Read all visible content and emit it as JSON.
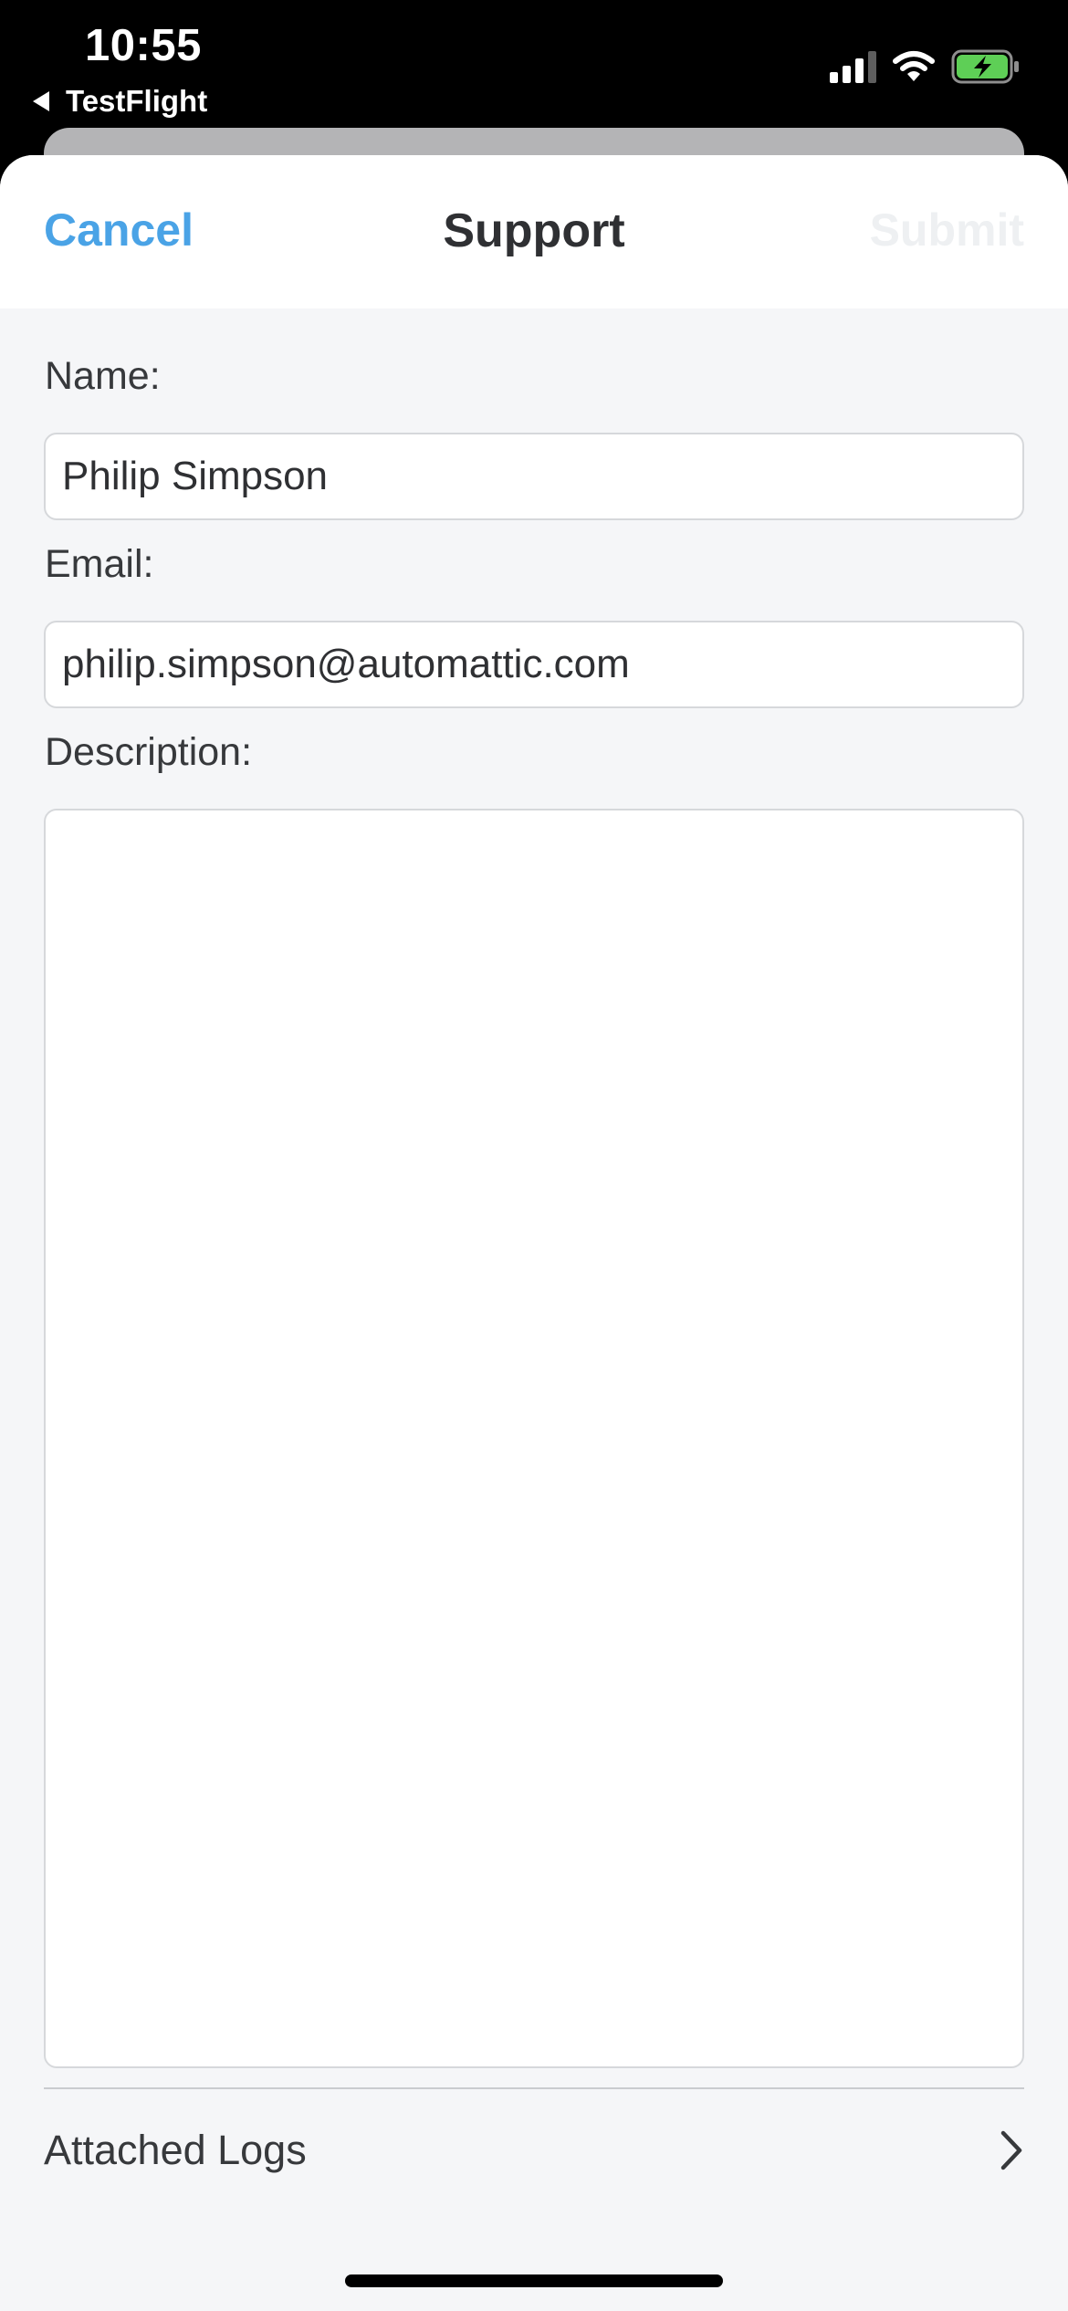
{
  "status_bar": {
    "time": "10:55",
    "back_app": "TestFlight",
    "icons": [
      "cellular-signal-icon",
      "wifi-icon",
      "battery-charging-icon"
    ]
  },
  "nav": {
    "cancel_label": "Cancel",
    "title": "Support",
    "submit_label": "Submit"
  },
  "form": {
    "name_label": "Name:",
    "name_value": "Philip Simpson",
    "email_label": "Email:",
    "email_value": "philip.simpson@automattic.com",
    "description_label": "Description:",
    "description_value": ""
  },
  "logs": {
    "label": "Attached Logs",
    "icon": "chevron-right-icon"
  },
  "colors": {
    "accent": "#4aa3e6",
    "sheet_background": "#f5f6f8",
    "battery": "#5ecf56"
  }
}
